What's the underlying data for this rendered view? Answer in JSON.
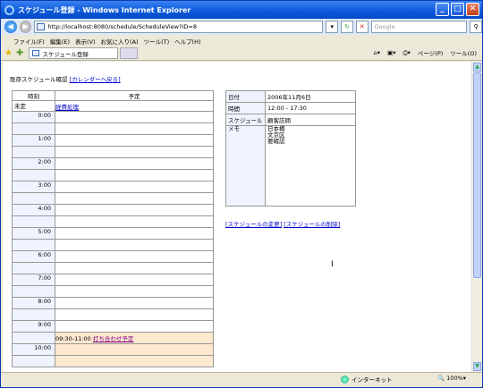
{
  "window": {
    "title": "スケジュール登録 - Windows Internet Explorer"
  },
  "address": {
    "url": "http://localhost:8080/schedule/ScheduleView?ID=8",
    "search_placeholder": "Google"
  },
  "menu": [
    "ファイル(F)",
    "編集(E)",
    "表示(V)",
    "お気に入り(A)",
    "ツール(T)",
    "ヘルプ(H)"
  ],
  "tab": {
    "label": "スケジュール登録"
  },
  "toolbar_right": {
    "page": "ページ(P)",
    "tools": "ツール(O)"
  },
  "page": {
    "heading": "既存スケジュール確認",
    "back_link": "[カレンダーへ戻る]",
    "schedule": {
      "col_time": "時刻",
      "col_plan": "予定",
      "untimed_label": "未定",
      "untimed_item": "経費処理",
      "hours": [
        "0:00",
        "1:00",
        "2:00",
        "3:00",
        "4:00",
        "5:00",
        "6:00",
        "7:00",
        "8:00",
        "9:00",
        "10:00"
      ],
      "event_time": "09:30-11:00",
      "event_title": "打ち合わせ予定"
    },
    "detail": {
      "date_label": "日付",
      "date_value": "2006年11月6日",
      "time_label": "時間",
      "time_value": "12:00 - 17:30",
      "sched_label": "スケジュール",
      "sched_value": "顧客訪問",
      "memo_label": "メモ",
      "memo_lines": [
        "日本橋",
        "文京区",
        "要確認"
      ]
    },
    "edit_link": "[スケジュールの変更]",
    "delete_link": "[スケジュールの削除]"
  },
  "status": {
    "zone": "インターネット",
    "zoom": "100%"
  }
}
